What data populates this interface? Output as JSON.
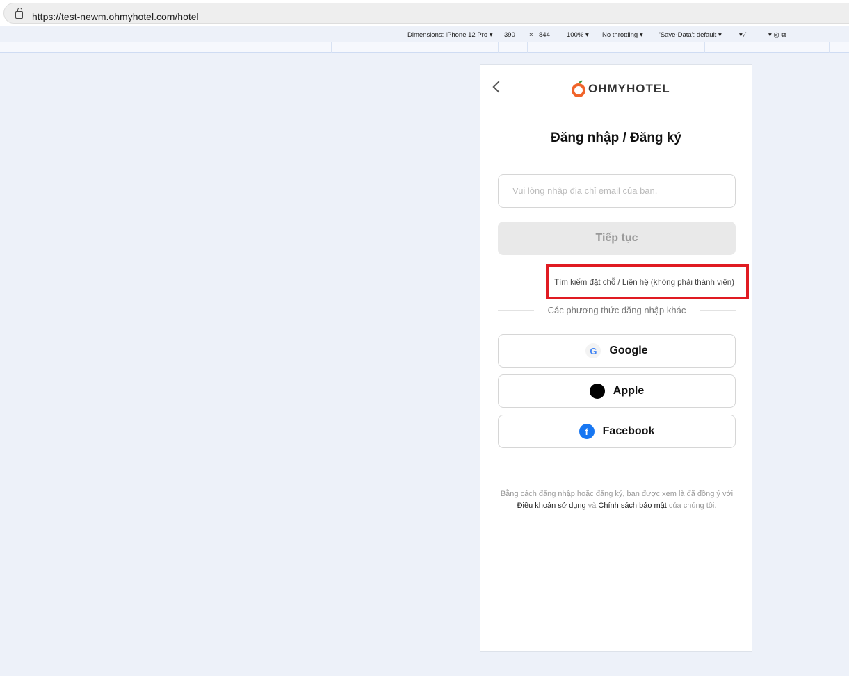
{
  "browser": {
    "url": "https://test-newm.ohmyhotel.com/hotel"
  },
  "devtools": {
    "dimensions": "Dimensions: iPhone 12 Pro",
    "width": "390",
    "times": "×",
    "height": "844",
    "zoom": "100%",
    "throttling": "No throttling",
    "save_data": "'Save-Data': default"
  },
  "page": {
    "logo": "OHMYHOTEL",
    "title": "Đăng nhập / Đăng ký",
    "email_placeholder": "Vui lòng nhập địa chỉ email của bạn.",
    "continue": "Tiếp tục",
    "guest_link": "Tìm kiếm đặt chỗ / Liên hệ (không phải thành viên)",
    "other_methods": "Các phương thức đăng nhập khác",
    "social": [
      {
        "label": "Google",
        "icon": "G"
      },
      {
        "label": "Apple",
        "icon": ""
      },
      {
        "label": "Facebook",
        "icon": "f"
      }
    ],
    "legal": {
      "line1": "Bằng cách đăng nhập hoặc đăng ký, bạn được xem là đã đồng ý với",
      "terms": "Điều khoản sử dụng",
      "and": " và ",
      "privacy": "Chính sách bảo mật",
      "tail": " của chúng tôi."
    }
  },
  "colors": {
    "annotation": "#e01b22",
    "facebook": "#1877f2",
    "apple": "#000000"
  }
}
